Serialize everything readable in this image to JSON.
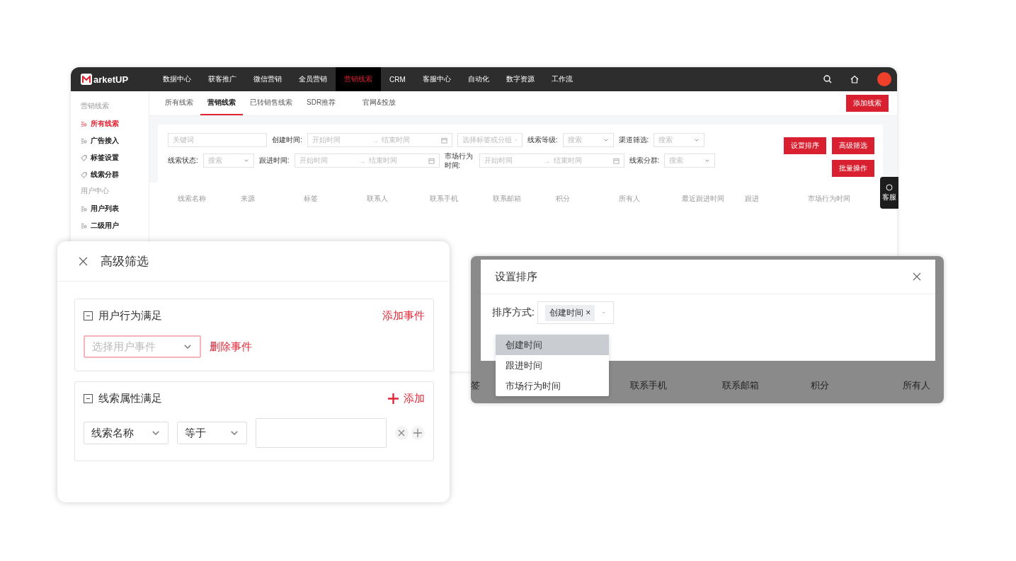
{
  "topbar": {
    "logo_text": "arketUP",
    "nav": [
      {
        "label": "数据中心",
        "selected": false
      },
      {
        "label": "获客推广",
        "selected": false
      },
      {
        "label": "微信营销",
        "selected": false
      },
      {
        "label": "全员营销",
        "selected": false
      },
      {
        "label": "营销线索",
        "selected": true
      },
      {
        "label": "CRM",
        "selected": false
      },
      {
        "label": "客服中心",
        "selected": false
      },
      {
        "label": "自动化",
        "selected": false
      },
      {
        "label": "数字资源",
        "selected": false
      },
      {
        "label": "工作流",
        "selected": false
      }
    ]
  },
  "sidebar": [
    {
      "title": "营销线索",
      "items": [
        {
          "label": "所有线索",
          "kind": "list",
          "selected": true
        },
        {
          "label": "广告接入",
          "kind": "list",
          "selected": false
        },
        {
          "label": "标签设置",
          "kind": "tag",
          "selected": false
        },
        {
          "label": "线索分群",
          "kind": "tag",
          "selected": false
        }
      ]
    },
    {
      "title": "用户中心",
      "items": [
        {
          "label": "用户列表",
          "kind": "list",
          "selected": false
        },
        {
          "label": "二级用户",
          "kind": "list",
          "selected": false
        }
      ]
    }
  ],
  "tabs": [
    {
      "label": "所有线索",
      "selected": false
    },
    {
      "label": "营销线索",
      "selected": true
    },
    {
      "label": "已转销售线索",
      "selected": false
    },
    {
      "label": "SDR推荐",
      "selected": false
    },
    {
      "label": "官网&投放",
      "selected": false
    }
  ],
  "add_button": "添加线索",
  "range_separator": "→",
  "filter_rows": [
    [
      {
        "kind": "input",
        "placeholder": "关键词"
      },
      {
        "kind": "range",
        "label": "创建时间:",
        "start": "开始时间",
        "end": "结束时间"
      },
      {
        "kind": "select",
        "placeholder": "选择标签或分组"
      },
      {
        "kind": "select",
        "label": "线索等级:",
        "placeholder": "搜索"
      },
      {
        "kind": "select",
        "label": "渠道筛选:",
        "placeholder": "搜索"
      }
    ],
    [
      {
        "kind": "select",
        "label": "线索状态:",
        "placeholder": "搜索"
      },
      {
        "kind": "range",
        "label": "跟进时间:",
        "start": "开始时间",
        "end": "结束时间"
      },
      {
        "kind": "range",
        "label": "市场行为时间:",
        "start": "开始时间",
        "end": "结束时间"
      },
      {
        "kind": "select",
        "label": "线索分群:",
        "placeholder": "搜索"
      }
    ]
  ],
  "action_buttons": [
    "设置排序",
    "高级筛选",
    "批量操作"
  ],
  "table_columns": [
    "线索名称",
    "来源",
    "标签",
    "联系人",
    "联系手机",
    "联系邮箱",
    "积分",
    "所有人",
    "最近跟进时间",
    "跟进",
    "市场行为时间"
  ],
  "service_tab": "客服",
  "filter_dialog": {
    "title": "高级筛选",
    "sections": [
      {
        "title": "用户行为满足",
        "action": "添加事件",
        "action_icon": false,
        "select_placeholder": "选择用户事件",
        "delete_label": "删除事件"
      },
      {
        "title": "线索属性满足",
        "action": "添加",
        "action_icon": true,
        "field": "线索名称",
        "operator": "等于"
      }
    ]
  },
  "sort_dialog": {
    "title": "设置排序",
    "label": "排序方式:",
    "chip": "创建时间",
    "chip_close": "×",
    "options": [
      {
        "label": "创建时间",
        "selected": true
      },
      {
        "label": "跟进时间",
        "selected": false
      },
      {
        "label": "市场行为时间",
        "selected": false
      }
    ],
    "background_headers": [
      "签",
      "联系手机",
      "联系邮箱",
      "积分",
      "所有人"
    ]
  }
}
